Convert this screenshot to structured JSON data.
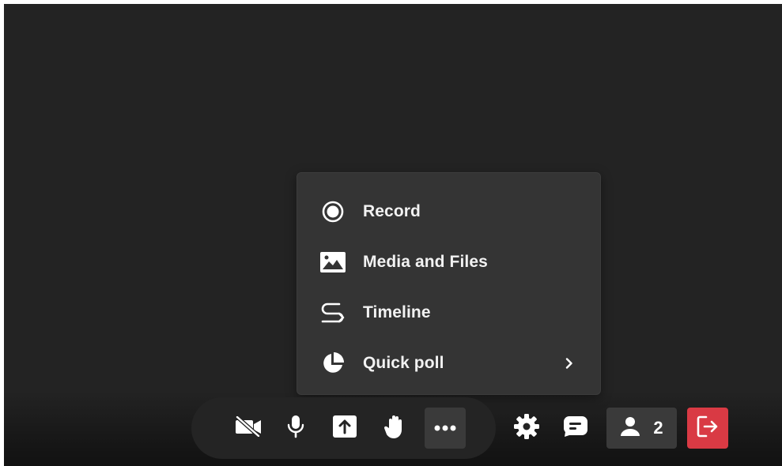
{
  "menu": {
    "items": [
      {
        "label": "Record",
        "icon": "record-icon"
      },
      {
        "label": "Media and Files",
        "icon": "image-icon"
      },
      {
        "label": "Timeline",
        "icon": "timeline-icon"
      },
      {
        "label": "Quick poll",
        "icon": "pie-chart-icon",
        "has_submenu": true
      }
    ]
  },
  "toolbar": {
    "buttons": [
      {
        "name": "camera-off-button",
        "icon": "video-off-icon"
      },
      {
        "name": "microphone-button",
        "icon": "microphone-icon"
      },
      {
        "name": "share-screen-button",
        "icon": "share-screen-icon"
      },
      {
        "name": "raise-hand-button",
        "icon": "hand-icon"
      },
      {
        "name": "more-options-button",
        "icon": "more-horizontal-icon",
        "active": true
      }
    ],
    "settings_icon": "gear-icon",
    "chat_icon": "chat-icon",
    "participants": {
      "icon": "user-icon",
      "count": "2"
    },
    "leave_icon": "leave-icon"
  },
  "colors": {
    "stage_background": "#232323",
    "menu_background": "#343434",
    "active_button": "#3a3a3a",
    "leave_button": "#d93a44",
    "icon": "#ffffff"
  }
}
